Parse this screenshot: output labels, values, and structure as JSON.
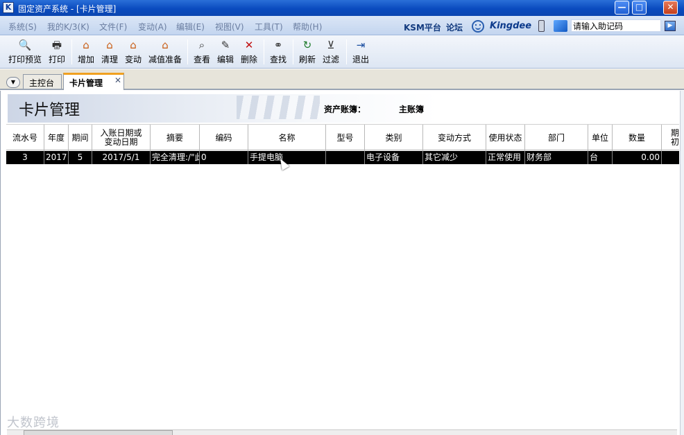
{
  "window": {
    "title": "固定资产系统 - [卡片管理]",
    "app_icon_letter": "K",
    "min_glyph": "—",
    "max_glyph": "□",
    "close_glyph": "✕"
  },
  "menu": {
    "items": [
      "系统(S)",
      "我的K/3(K)",
      "文件(F)",
      "变动(A)",
      "编辑(E)",
      "视图(V)",
      "工具(T)",
      "帮助(H)"
    ],
    "brand_ksm": "KSM平台",
    "brand_forum": "论坛",
    "brand_kingdee": "Kingdee",
    "helper_placeholder": "请输入助记码",
    "helper_value": "请输入助记码",
    "go_glyph": "▶"
  },
  "toolbar": {
    "print_preview": "打印预览",
    "print": "打印",
    "add": "增加",
    "clear": "清理",
    "change": "变动",
    "impairment": "减值准备",
    "view": "查看",
    "edit": "编辑",
    "delete": "删除",
    "find": "查找",
    "refresh": "刷新",
    "filter": "过滤",
    "exit": "退出",
    "icons": {
      "print_preview": "🔍",
      "print": "🖶",
      "house": "⌂",
      "view": "⌕",
      "edit": "✎",
      "delete": "✕",
      "find": "⚭",
      "refresh": "↻",
      "filter": "⊻",
      "exit": "⇥"
    }
  },
  "tabs": {
    "nav_glyph": "▼",
    "main": "主控台",
    "card": "卡片管理",
    "close_glyph": "✕"
  },
  "banner": {
    "title": "卡片管理",
    "ledger_label": "资产账簿：",
    "ledger_value": "主账簿"
  },
  "grid": {
    "headers": [
      "流水号",
      "年度",
      "期间",
      "入账日期或变动日期",
      "摘要",
      "编码",
      "名称",
      "型号",
      "类别",
      "变动方式",
      "使用状态",
      "部门",
      "单位",
      "数量",
      "期初"
    ],
    "header_line2": "变动日期",
    "header_line1": "入账日期或",
    "row": {
      "serial": "3",
      "year": "2017",
      "period": "5",
      "date": "2017/5/1",
      "summary": "完全清理:/\"此",
      "code": "0",
      "name": "手提电脑",
      "model": "",
      "category": "电子设备",
      "change_method": "其它减少",
      "status": "正常使用",
      "department": "财务部",
      "unit": "台",
      "quantity": "0.00",
      "opening": ""
    }
  },
  "watermark": "大数跨境",
  "colors": {
    "titlebar": "#0a4bbf",
    "menubar": "#c3d5ef",
    "selected_row": "#000000",
    "tab_accent": "#f0a020"
  }
}
